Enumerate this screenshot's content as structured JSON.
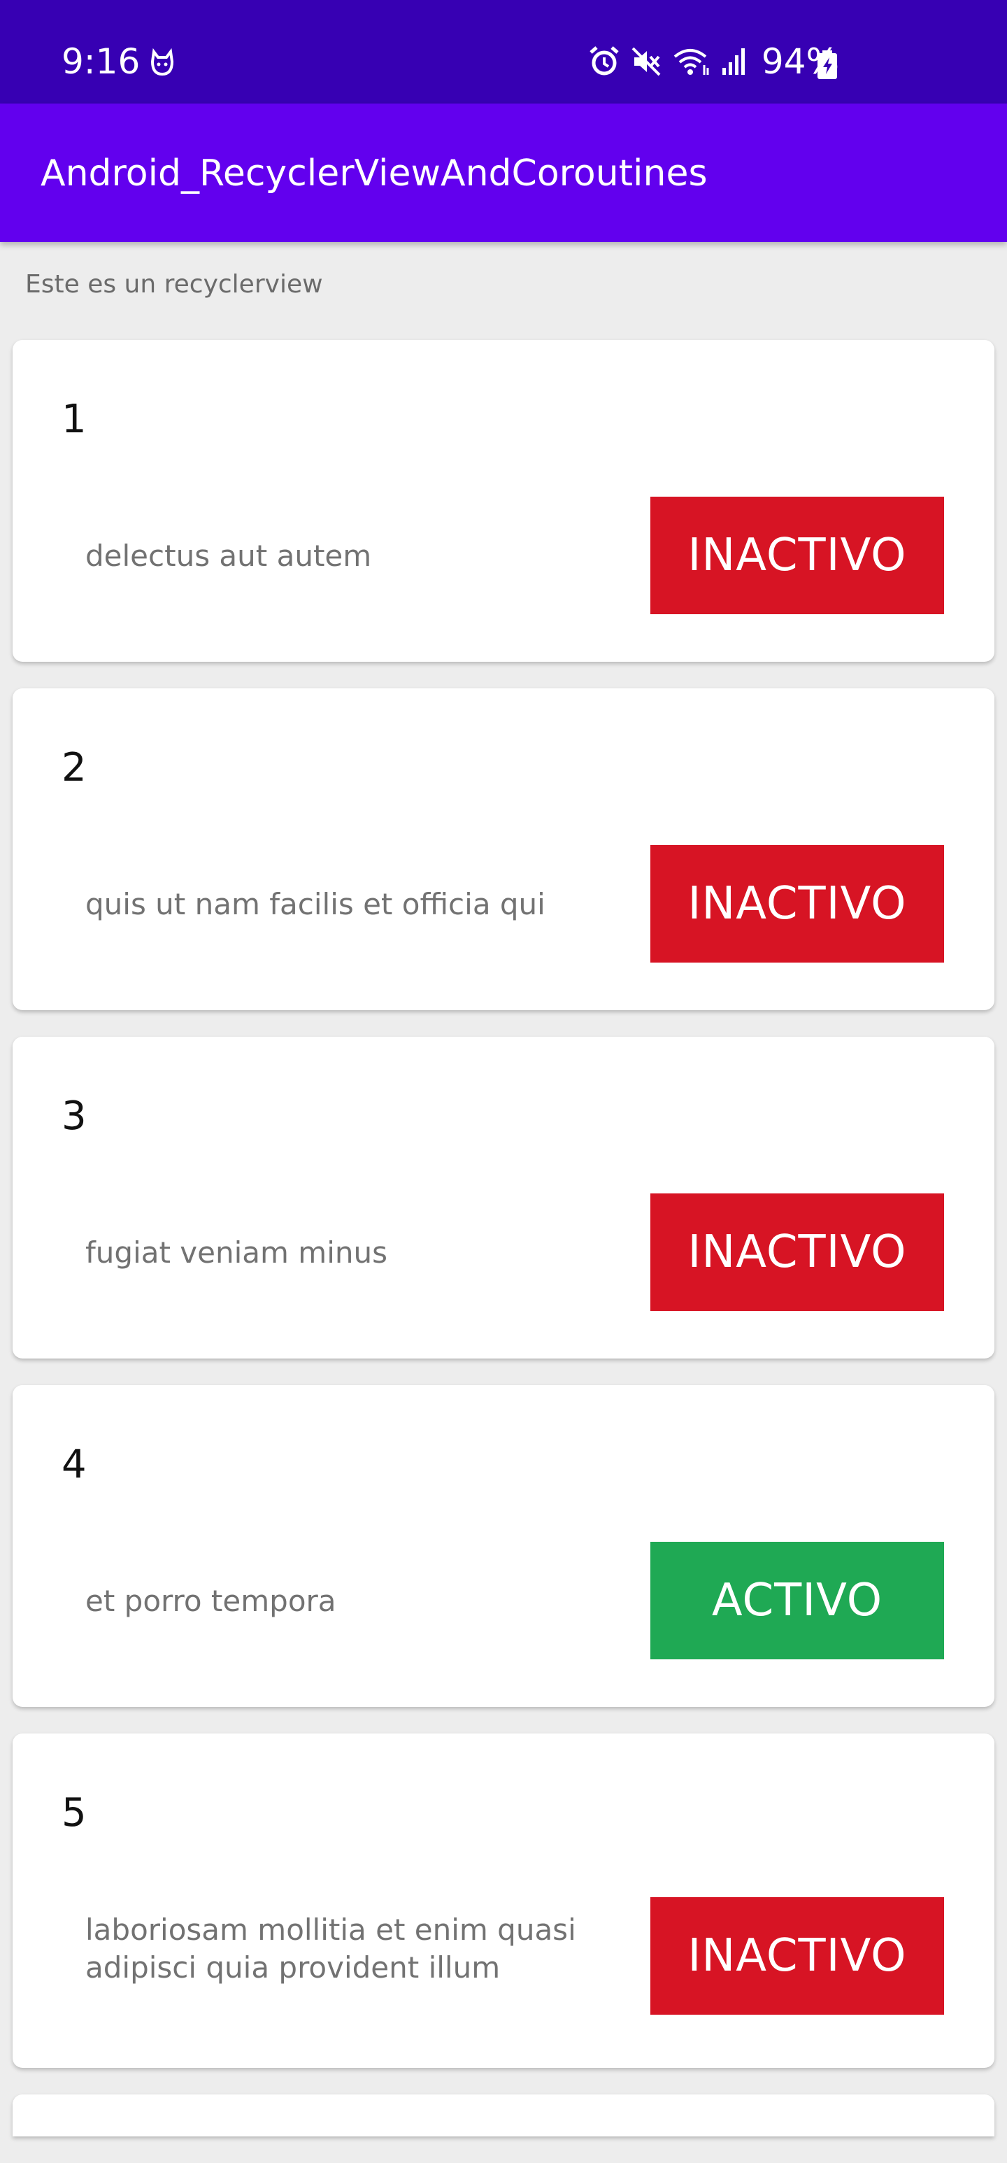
{
  "status_bar": {
    "time": "9:16",
    "battery": "94%",
    "icons": [
      "pet-notification-icon",
      "alarm-icon",
      "mute-icon",
      "wifi-icon",
      "signal-icon",
      "battery-charging-icon"
    ]
  },
  "app_bar": {
    "title": "Android_RecyclerViewAndCoroutines"
  },
  "header": {
    "text": "Este es un recyclerview"
  },
  "colors": {
    "status_bar": "#3700b3",
    "app_bar": "#6200ee",
    "inactive": "#d71424",
    "active": "#1fa954"
  },
  "items": [
    {
      "id": "1",
      "title": "delectus aut autem",
      "status": "INACTIVO"
    },
    {
      "id": "2",
      "title": "quis ut nam facilis et officia qui",
      "status": "INACTIVO"
    },
    {
      "id": "3",
      "title": "fugiat veniam minus",
      "status": "INACTIVO"
    },
    {
      "id": "4",
      "title": "et porro tempora",
      "status": "ACTIVO"
    },
    {
      "id": "5",
      "title": "laboriosam mollitia et enim quasi adipisci quia provident illum",
      "status": "INACTIVO"
    }
  ]
}
